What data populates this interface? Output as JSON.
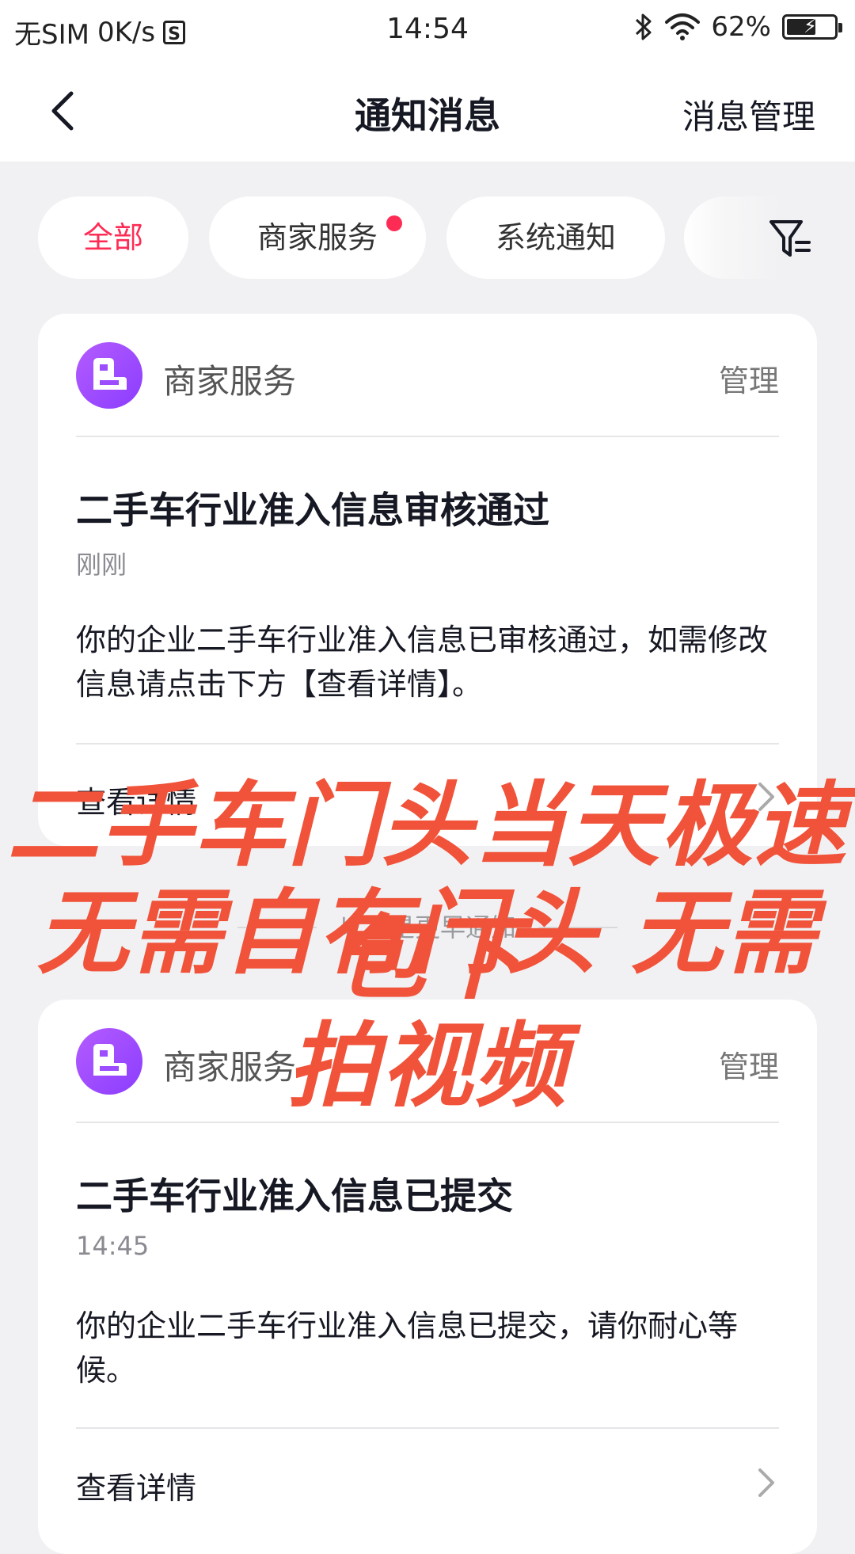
{
  "status_bar": {
    "carrier": "无SIM",
    "network_speed": "0K/s",
    "sim_icon": "S",
    "time": "14:54",
    "battery": "62%",
    "battery_level": 0.62
  },
  "nav": {
    "title": "通知消息",
    "manage": "消息管理"
  },
  "tabs": [
    {
      "label": "全部",
      "active": true
    },
    {
      "label": "商家服务",
      "badge": true
    },
    {
      "label": "系统通知"
    }
  ],
  "cards": [
    {
      "sender": "商家服务",
      "manage": "管理",
      "title": "二手车行业准入信息审核通过",
      "time": "刚刚",
      "body": "你的企业二手车行业准入信息已审核通过，如需修改信息请点击下方【查看详情】。",
      "detail": "查看详情"
    },
    {
      "sender": "商家服务",
      "manage": "管理",
      "title": "二手车行业准入信息已提交",
      "time": "14:45",
      "body": "你的企业二手车行业准入信息已提交，请你耐心等候。",
      "detail": "查看详情"
    }
  ],
  "separator": "以下是更早通知",
  "overlay": {
    "line1": "二手车门头当天极速包下",
    "line2": "无需自有门头 无需拍视频",
    "color": "#f0533a"
  },
  "colors": {
    "accent": "#fe2c55",
    "avatar": "#9b4dff"
  }
}
